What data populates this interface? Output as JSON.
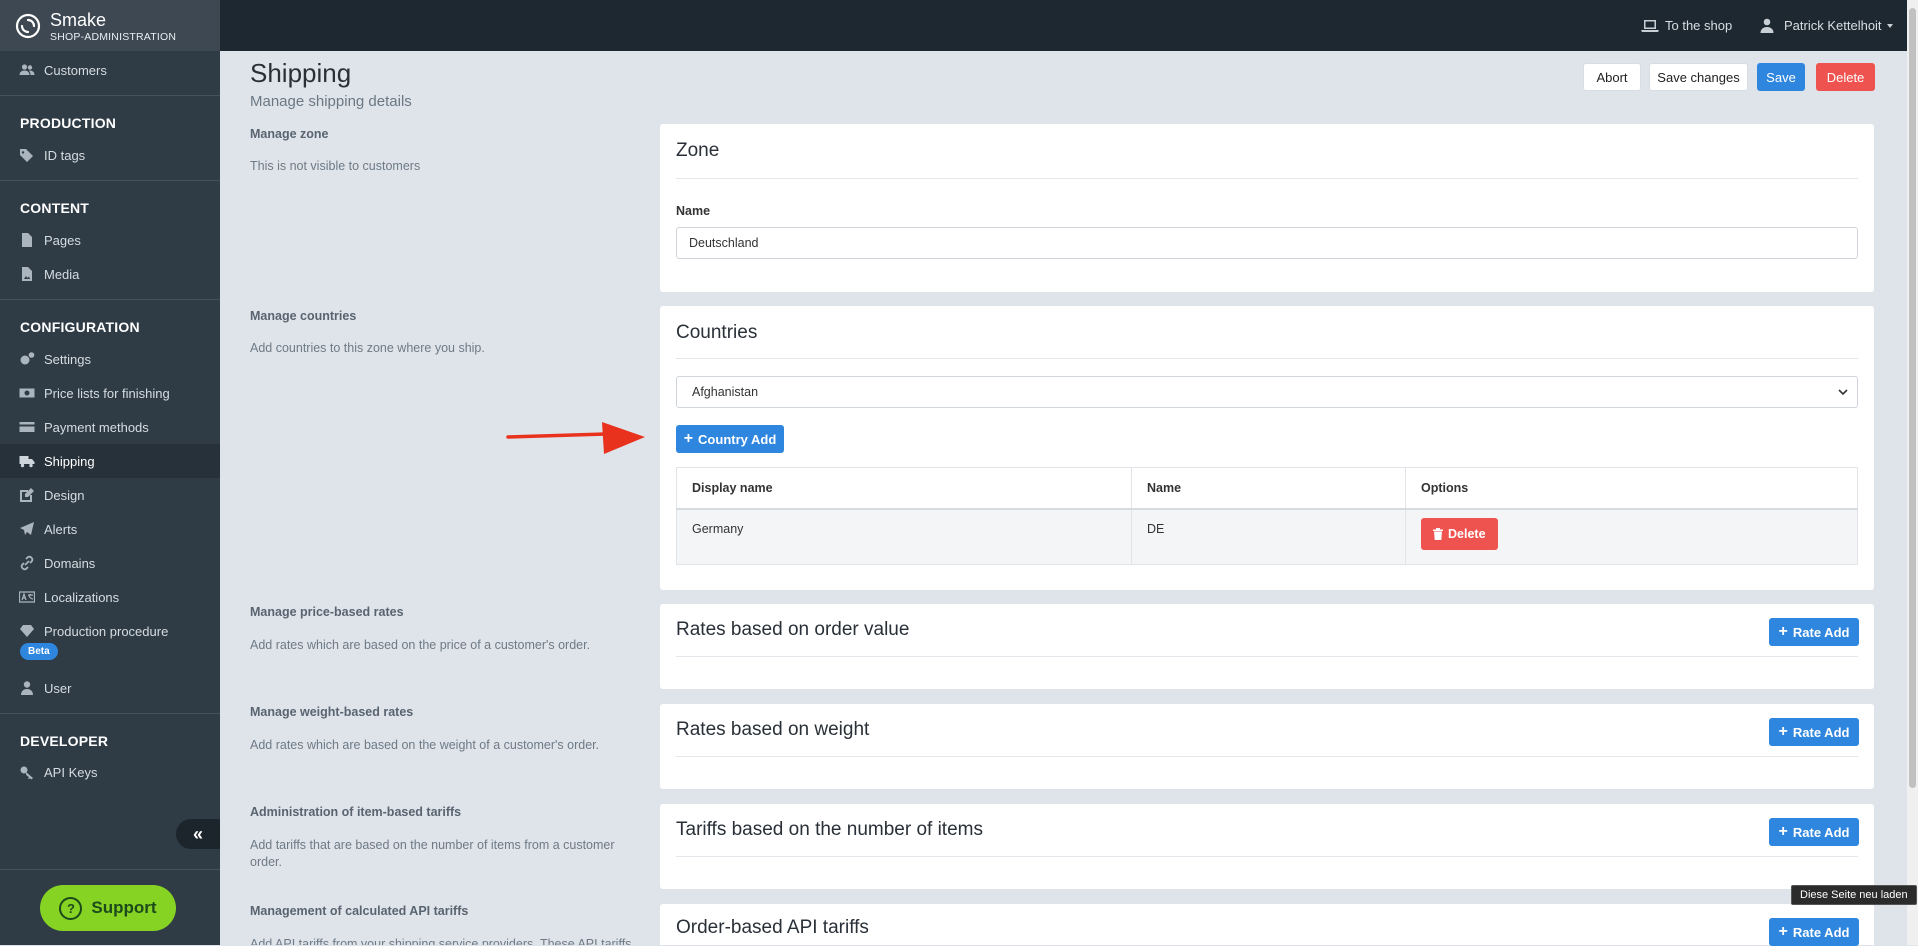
{
  "brand": {
    "name": "Smake",
    "subtitle": "SHOP-ADMINISTRATION"
  },
  "sidebar": {
    "items_top": [
      {
        "label": "Customers",
        "icon": "users-icon"
      }
    ],
    "sections": [
      {
        "title": "PRODUCTION",
        "items": [
          {
            "label": "ID tags",
            "icon": "tags-icon"
          }
        ]
      },
      {
        "title": "CONTENT",
        "items": [
          {
            "label": "Pages",
            "icon": "file-icon"
          },
          {
            "label": "Media",
            "icon": "file-image-icon"
          }
        ]
      },
      {
        "title": "CONFIGURATION",
        "items": [
          {
            "label": "Settings",
            "icon": "cogs-icon"
          },
          {
            "label": "Price lists for finishing",
            "icon": "money-icon"
          },
          {
            "label": "Payment methods",
            "icon": "credit-card-icon"
          },
          {
            "label": "Shipping",
            "icon": "truck-icon",
            "active": true
          },
          {
            "label": "Design",
            "icon": "edit-icon"
          },
          {
            "label": "Alerts",
            "icon": "paper-plane-icon"
          },
          {
            "label": "Domains",
            "icon": "link-icon"
          },
          {
            "label": "Localizations",
            "icon": "language-icon"
          },
          {
            "label": "Production procedure",
            "icon": "diamond-icon",
            "badge": "Beta"
          },
          {
            "label": "User",
            "icon": "user-icon"
          }
        ]
      },
      {
        "title": "DEVELOPER",
        "items": [
          {
            "label": "API Keys",
            "icon": "key-icon"
          }
        ]
      }
    ],
    "collapse_label": "«",
    "support_label": "Support"
  },
  "topbar": {
    "shop_link": "To the shop",
    "user_name": "Patrick Kettelhoit"
  },
  "page": {
    "title": "Shipping",
    "subtitle": "Manage shipping details",
    "actions": {
      "abort": "Abort",
      "save_changes": "Save changes",
      "save": "Save",
      "delete": "Delete"
    }
  },
  "sections": {
    "zone": {
      "left_title": "Manage zone",
      "left_desc": "This is not visible to customers",
      "card_title": "Zone",
      "name_label": "Name",
      "name_value": "Deutschland"
    },
    "countries": {
      "left_title": "Manage countries",
      "left_desc": "Add countries to this zone where you ship.",
      "card_title": "Countries",
      "select_value": "Afghanistan",
      "add_button": "Country Add",
      "table": {
        "headers": [
          "Display name",
          "Name",
          "Options"
        ],
        "rows": [
          {
            "display_name": "Germany",
            "name": "DE",
            "option": "Delete"
          }
        ]
      }
    },
    "price_rates": {
      "left_title": "Manage price-based rates",
      "left_desc": "Add rates which are based on the price of a customer's order.",
      "card_title": "Rates based on order value",
      "add_button": "Rate Add"
    },
    "weight_rates": {
      "left_title": "Manage weight-based rates",
      "left_desc": "Add rates which are based on the weight of a customer's order.",
      "card_title": "Rates based on weight",
      "add_button": "Rate Add"
    },
    "item_tariffs": {
      "left_title": "Administration of item-based tariffs",
      "left_desc": "Add tariffs that are based on the number of items from a customer order.",
      "card_title": "Tariffs based on the number of items",
      "add_button": "Rate Add"
    },
    "api_tariffs": {
      "left_title": "Management of calculated API tariffs",
      "left_desc": "Add API tariffs from your shipping service providers. These API tariffs",
      "card_title": "Order-based API tariffs",
      "add_button": "Rate Add"
    }
  },
  "tooltip": "Diese Seite neu laden",
  "colors": {
    "sidebar": "#2f3b45",
    "topbar": "#1e2831",
    "primary": "#2e86de",
    "danger": "#ef5350",
    "support": "#86d323",
    "arrow": "#e8321e"
  }
}
